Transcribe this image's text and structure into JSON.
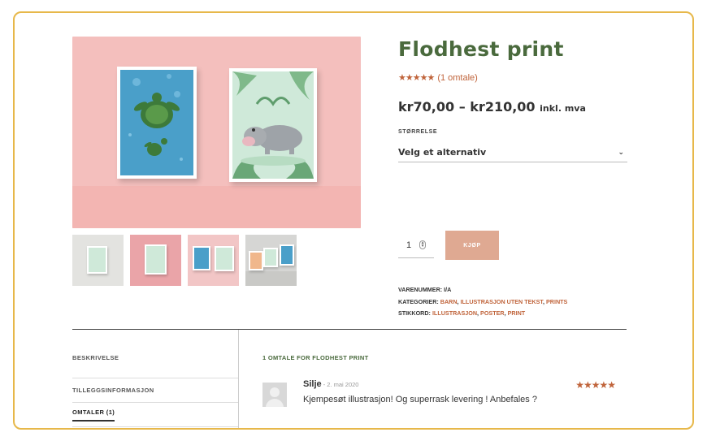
{
  "product": {
    "title": "Flodhest print",
    "rating_stars": "★★★★★",
    "review_link": "(1 omtale)",
    "price": "kr70,00 – kr210,00",
    "tax_note": "inkl. mva",
    "variant_label": "STØRRELSE",
    "variant_select": "Velg et alternativ",
    "quantity": "1",
    "buy_label": "KJØP"
  },
  "meta": {
    "sku_label": "VARENUMMER:",
    "sku_value": "I/A",
    "categories_label": "KATEGORIER:",
    "categories": [
      "BARN",
      "ILLUSTRASJON UTEN TEKST",
      "PRINTS"
    ],
    "tags_label": "STIKKORD:",
    "tags": [
      "ILLUSTRASJON",
      "POSTER",
      "PRINT"
    ]
  },
  "tabs": [
    {
      "label": "BESKRIVELSE"
    },
    {
      "label": "TILLEGGSINFORMASJON"
    },
    {
      "label": "OMTALER (1)"
    }
  ],
  "reviews": {
    "title": "1 OMTALE FOR FLODHEST PRINT",
    "items": [
      {
        "author": "Silje",
        "date": " - 2. mai 2020",
        "stars": "★★★★★",
        "text": "Kjempesøt illustrasjon! Og superrask levering ! Anbefales ?"
      }
    ]
  },
  "colors": {
    "accent": "#c0643b",
    "title_green": "#4a6a3d",
    "buy_button": "#dfa992",
    "frame_border": "#e7b84a",
    "image_background": "#f4bfbd"
  },
  "icons": {
    "select": "chevron-down-icon",
    "quantity": "spinner-icon",
    "avatar": "user-avatar-placeholder"
  }
}
